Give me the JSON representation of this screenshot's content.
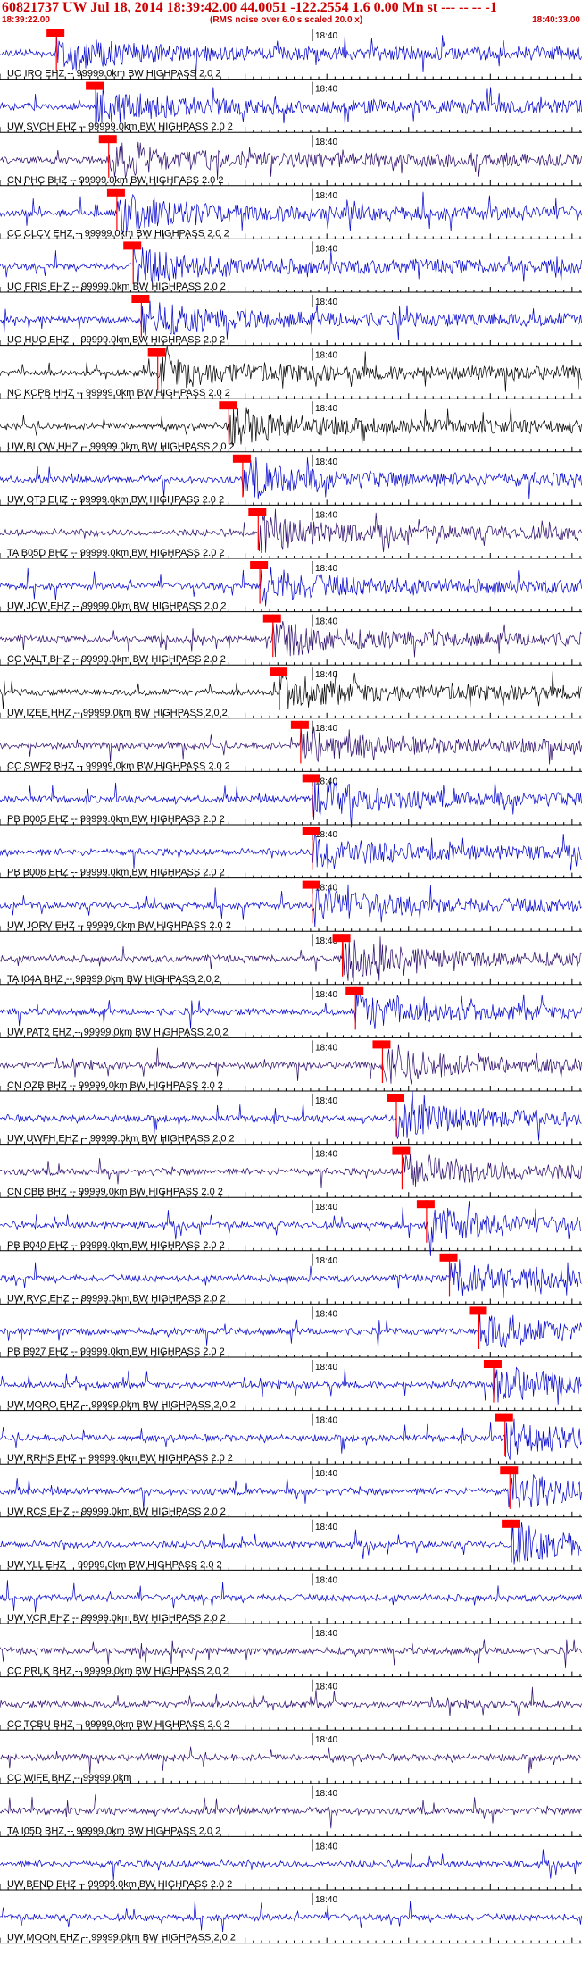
{
  "header": {
    "event_line": "60821737 UW Jul 18, 2014 18:39:42.00   44.0051 -122.2554  1.6 0.00 Mn st --- -- --   -1",
    "time_start": "18:39:22.00",
    "note": "(RMS noise over 6.0 s scaled 20.0 x)",
    "time_end": "18:40:33.00",
    "center_time_label": "18:40"
  },
  "colors": {
    "header_text": "#cc0000",
    "pick_box": "#ff0000",
    "trace_blue": "#0000cc",
    "trace_black": "#000000",
    "trace_purple": "#2a0a6a",
    "axis": "#000000"
  },
  "chart_data": {
    "type": "seismogram",
    "x_range_seconds": [
      "18:39:22.00",
      "18:40:33.00"
    ],
    "tick_label": "18:40",
    "traces": [
      {
        "label": "UO IRO EHZ -- 99999.0km BW  HIGHPASS  2.0  2",
        "color": "blue",
        "pick_s": 6.9
      },
      {
        "label": "UW SVOH EHZ -- 99999.0km BW  HIGHPASS  2.0  2",
        "color": "blue",
        "pick_s": 11.7
      },
      {
        "label": "CN PHC BHZ -- 99999.0km BW  HIGHPASS  2.0  2",
        "color": "purple",
        "pick_s": 13.3
      },
      {
        "label": "CC CLCV EHZ -- 99999.0km BW  HIGHPASS  2.0  2",
        "color": "blue",
        "pick_s": 14.3
      },
      {
        "label": "UO FRIS EHZ -- 99999.0km BW  HIGHPASS  2.0  2",
        "color": "blue",
        "pick_s": 16.3
      },
      {
        "label": "UO HUO EHZ -- 99999.0km BW  HIGHPASS  2.0  2",
        "color": "blue",
        "pick_s": 17.3
      },
      {
        "label": "NC KCPB HHZ -- 99999.0km BW  HIGHPASS  2.0  2",
        "color": "black",
        "pick_s": 19.3
      },
      {
        "label": "UW BLOW HHZ -- 99999.0km BW  HIGHPASS  2.0  2",
        "color": "black",
        "pick_s": 28.0
      },
      {
        "label": "UW OT3 EHZ -- 99999.0km BW  HIGHPASS  2.0  2",
        "color": "blue",
        "pick_s": 29.7
      },
      {
        "label": "TA B05D BHZ -- 99999.0km BW  HIGHPASS  2.0  2",
        "color": "purple",
        "pick_s": 31.6
      },
      {
        "label": "UW JCW EHZ -- 99999.0km BW  HIGHPASS  2.0  2",
        "color": "blue",
        "pick_s": 31.8
      },
      {
        "label": "CC VALT BHZ -- 99999.0km BW  HIGHPASS  2.0  2",
        "color": "purple",
        "pick_s": 33.4
      },
      {
        "label": "UW IZEE HHZ -- 99999.0km BW  HIGHPASS  2.0  2",
        "color": "black",
        "pick_s": 34.2
      },
      {
        "label": "CC SWF2 BHZ -- 99999.0km BW  HIGHPASS  2.0  2",
        "color": "purple",
        "pick_s": 36.8
      },
      {
        "label": "PB B005 EHZ -- 99999.0km BW  HIGHPASS  2.0  2",
        "color": "blue",
        "pick_s": 38.2
      },
      {
        "label": "PB B006 EHZ -- 99999.0km BW  HIGHPASS  2.0  2",
        "color": "blue",
        "pick_s": 38.2
      },
      {
        "label": "UW JORV EHZ -- 99999.0km BW  HIGHPASS  2.0  2",
        "color": "blue",
        "pick_s": 38.2
      },
      {
        "label": "TA I04A BHZ -- 99999.0km BW  HIGHPASS  2.0  2",
        "color": "purple",
        "pick_s": 41.9
      },
      {
        "label": "UW PAT2 EHZ -- 99999.0km BW  HIGHPASS  2.0  2",
        "color": "blue",
        "pick_s": 43.5
      },
      {
        "label": "CN OZB BHZ -- 99999.0km BW  HIGHPASS  2.0  2",
        "color": "purple",
        "pick_s": 46.8
      },
      {
        "label": "UW UWFH EHZ -- 99999.0km BW  HIGHPASS  2.0  2",
        "color": "blue",
        "pick_s": 48.5
      },
      {
        "label": "CN CBB BHZ -- 99999.0km BW  HIGHPASS  2.0  2",
        "color": "purple",
        "pick_s": 49.2
      },
      {
        "label": "PB B040 EHZ -- 99999.0km BW  HIGHPASS  2.0  2",
        "color": "blue",
        "pick_s": 52.2
      },
      {
        "label": "UW RVC EHZ -- 99999.0km BW  HIGHPASS  2.0  2",
        "color": "blue",
        "pick_s": 55.0
      },
      {
        "label": "PB B927 EHZ -- 99999.0km BW  HIGHPASS  2.0  2",
        "color": "blue",
        "pick_s": 58.6
      },
      {
        "label": "UW MORO EHZ -- 99999.0km BW  HIGHPASS  2.0  2",
        "color": "blue",
        "pick_s": 60.4
      },
      {
        "label": "UW RRHS EHZ -- 99999.0km BW  HIGHPASS  2.0  2",
        "color": "blue",
        "pick_s": 61.8
      },
      {
        "label": "UW RCS EHZ -- 99999.0km BW  HIGHPASS  2.0  2",
        "color": "blue",
        "pick_s": 62.4
      },
      {
        "label": "UW YLL EHZ -- 99999.0km BW  HIGHPASS  2.0  2",
        "color": "blue",
        "pick_s": 62.6
      },
      {
        "label": "UW VCR EHZ -- 99999.0km BW  HIGHPASS  2.0  2",
        "color": "blue",
        "pick_s": null
      },
      {
        "label": "CC PRLK BHZ -- 99999.0km BW  HIGHPASS  2.0  2",
        "color": "purple",
        "pick_s": null
      },
      {
        "label": "CC TCBU BHZ -- 99999.0km BW  HIGHPASS  2.0  2",
        "color": "purple",
        "pick_s": null
      },
      {
        "label": "CC WIFE BHZ -- 99999.0km",
        "color": "purple",
        "pick_s": null
      },
      {
        "label": "TA I05D BHZ -- 99999.0km BW  HIGHPASS  2.0  2",
        "color": "purple",
        "pick_s": null
      },
      {
        "label": "UW BEND EHZ -- 99999.0km BW  HIGHPASS  2.0  2",
        "color": "blue",
        "pick_s": null
      },
      {
        "label": "UW MOON EHZ -- 99999.0km BW  HIGHPASS  2.0  2",
        "color": "blue",
        "pick_s": null
      }
    ]
  }
}
